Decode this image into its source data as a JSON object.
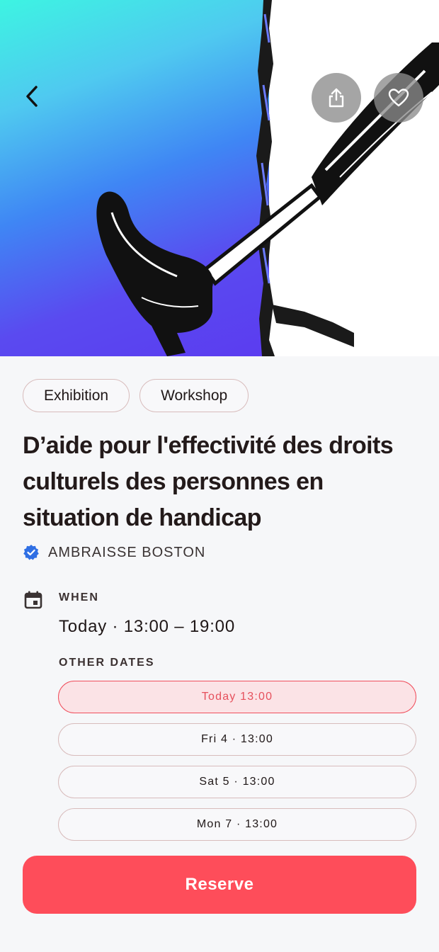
{
  "event": {
    "tags": [
      "Exhibition",
      "Workshop"
    ],
    "title": "D’aide pour l'effectivité des droits culturels des personnes en situation de handicap",
    "organizer": "AMBRAISSE BOSTON"
  },
  "schedule": {
    "when_label": "WHEN",
    "when_value": "Today · 13:00 – 19:00",
    "other_dates_label": "OTHER DATES",
    "dates": [
      {
        "label": "Today 13:00",
        "selected": true
      },
      {
        "label": "Fri 4 · 13:00",
        "selected": false
      },
      {
        "label": "Sat 5 · 13:00",
        "selected": false
      },
      {
        "label": "Mon 7 · 13:00",
        "selected": false
      }
    ]
  },
  "actions": {
    "reserve_label": "Reserve"
  },
  "colors": {
    "accent": "#fe4d5a",
    "selected_bg": "#fbe3e6",
    "verified": "#2f6fe4"
  },
  "icons": [
    "back-arrow-icon",
    "share-icon",
    "heart-icon",
    "verified-badge-icon",
    "calendar-icon"
  ]
}
